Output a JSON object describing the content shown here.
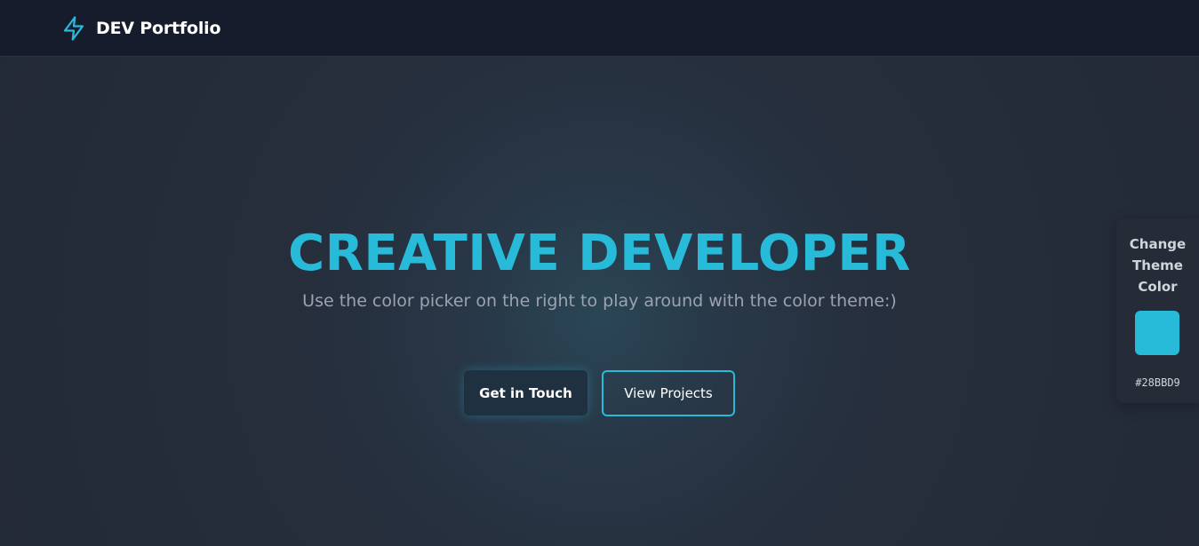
{
  "nav": {
    "brand": "DEV Portfolio",
    "logo_icon": "lightning-bolt-icon",
    "accent": "#28BBD9"
  },
  "hero": {
    "title": "CREATIVE DEVELOPER",
    "subtitle": "Use the color picker on the right to play around with the color theme:)",
    "primary_button": "Get in Touch",
    "secondary_button": "View Projects"
  },
  "theme_picker": {
    "label_line1": "Change",
    "label_line2": "Theme",
    "label_line3": "Color",
    "current_color": "#28BBD9",
    "current_color_label": "#28BBD9"
  },
  "colors": {
    "accent": "#28BBD9",
    "navbar_bg": "#161C2B",
    "page_bg": "#262F3D"
  }
}
